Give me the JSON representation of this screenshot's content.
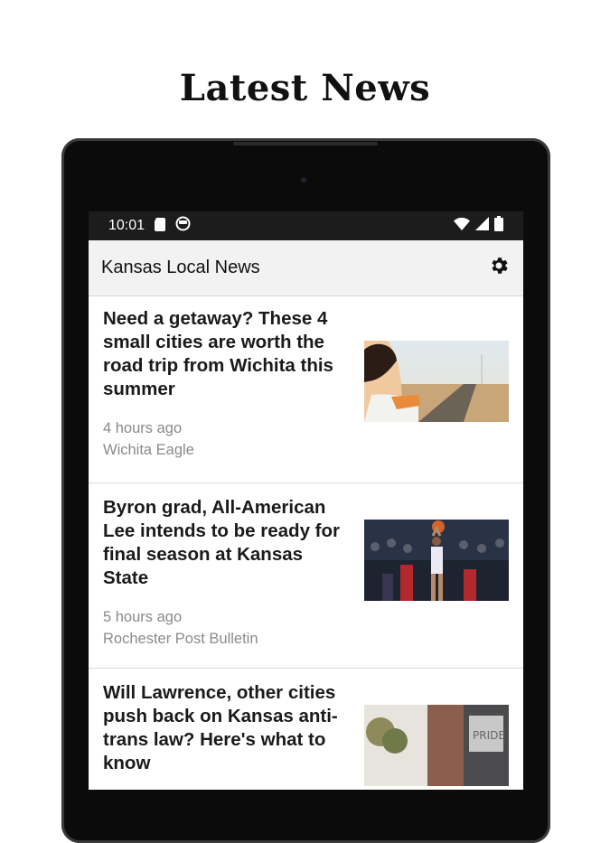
{
  "page": {
    "headline": "Latest News"
  },
  "status_bar": {
    "time": "10:01"
  },
  "app_bar": {
    "title": "Kansas Local News",
    "settings_icon": "gear-icon"
  },
  "articles": [
    {
      "title": "Need a getaway? These 4 small cities are worth the road trip from Wichita this summer",
      "time": "4 hours ago",
      "source": "Wichita Eagle",
      "image": "woman-in-car-window-photo"
    },
    {
      "title": "Byron grad, All-American Lee intends to be ready for final season at Kansas State",
      "time": "5 hours ago",
      "source": "Rochester Post Bulletin",
      "image": "basketball-player-shooting-photo"
    },
    {
      "title": "Will Lawrence, other cities push back on Kansas anti-trans law? Here's what to know",
      "time": "",
      "source": "",
      "image": "city-street-photo"
    }
  ],
  "colors": {
    "status_bar": "#1c1c1c",
    "app_bar": "#f2f2f2",
    "device": "#0b0b0b",
    "meta_text": "#8a8a8a"
  }
}
